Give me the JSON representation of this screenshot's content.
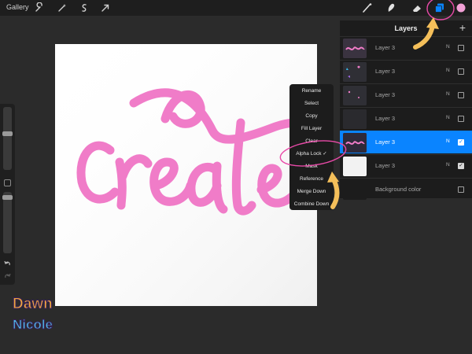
{
  "toolbar": {
    "gallery_label": "Gallery",
    "left_icons": [
      "wrench-icon",
      "magic-wand-icon",
      "selection-icon",
      "transform-arrow-icon"
    ],
    "right_icons": [
      "brush-icon",
      "smudge-icon",
      "eraser-icon",
      "layers-icon",
      "color-swatch-icon"
    ],
    "accent": "#0a84ff",
    "current_color": "#f2a0d6"
  },
  "layers_panel": {
    "title": "Layers",
    "add_label": "+",
    "layers": [
      {
        "name": "Layer 3",
        "blend": "N",
        "visible": false,
        "thumb": "create-art"
      },
      {
        "name": "Layer 3",
        "blend": "N",
        "visible": false,
        "thumb": "hearts"
      },
      {
        "name": "Layer 3",
        "blend": "N",
        "visible": false,
        "thumb": "dots"
      },
      {
        "name": "Layer 3",
        "blend": "N",
        "visible": false,
        "thumb": "dark"
      },
      {
        "name": "Layer 3",
        "blend": "N",
        "visible": true,
        "thumb": "create-art",
        "active": true
      },
      {
        "name": "Layer 3",
        "blend": "N",
        "visible": true,
        "thumb": "white"
      }
    ],
    "background": {
      "name": "Background color",
      "visible": false
    }
  },
  "context_menu": {
    "items": [
      "Rename",
      "Select",
      "Copy",
      "Fill Layer",
      "Clear",
      "Alpha Lock ✓",
      "Mask",
      "Reference",
      "Merge Down",
      "Combine Down"
    ]
  },
  "canvas": {
    "artwork_text": "create",
    "artwork_color": "#f07cc8"
  },
  "logo": {
    "line1": "Dawn",
    "line2": "Nicole"
  },
  "sidebar": {
    "icons": [
      "undo-icon",
      "redo-icon"
    ]
  }
}
